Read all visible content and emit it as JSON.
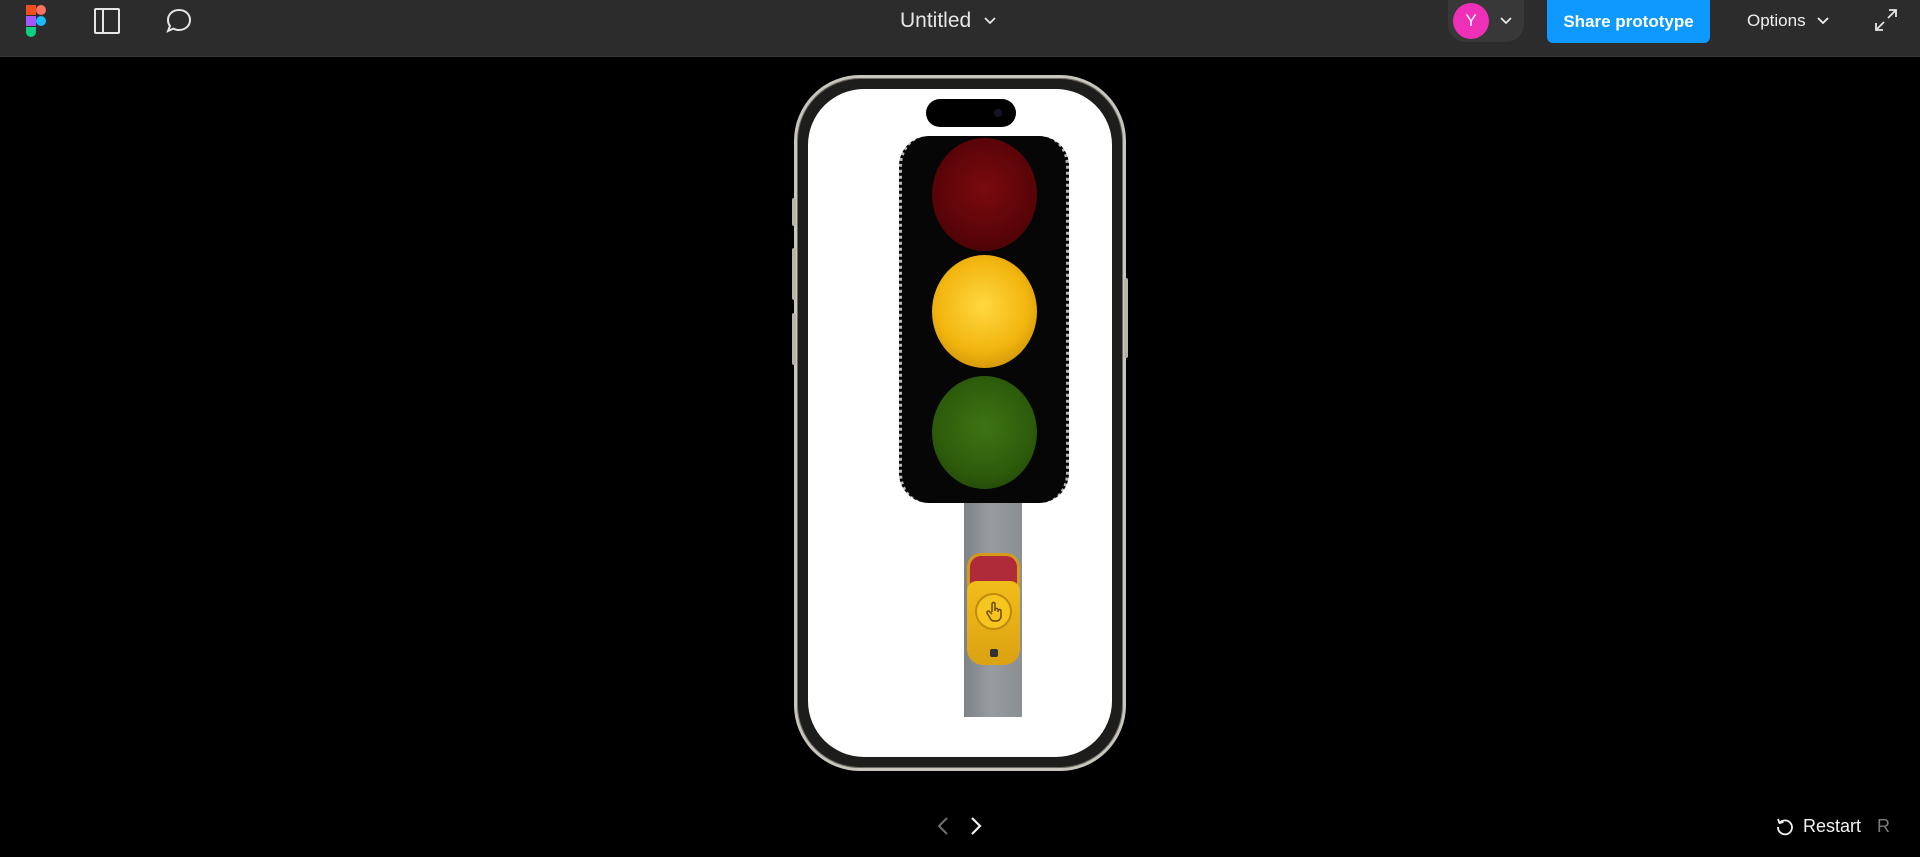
{
  "header": {
    "title": "Untitled",
    "avatar_initial": "Y",
    "share_label": "Share prototype",
    "options_label": "Options"
  },
  "footer": {
    "restart_label": "Restart",
    "restart_shortcut": "R"
  },
  "colors": {
    "topbar_bg": "#2c2c2c",
    "share_button": "#0d99ff",
    "avatar": "#ee2fb8",
    "canvas_bg": "#000000"
  },
  "icons": {
    "logo": "figma-logo-icon",
    "panel": "sidebar-panel-icon",
    "comment": "comment-bubble-icon",
    "title_dropdown": "chevron-down-icon",
    "avatar_dropdown": "chevron-down-icon",
    "options_dropdown": "chevron-down-icon",
    "fullscreen": "expand-icon",
    "previous": "chevron-left-icon",
    "next": "chevron-right-icon",
    "restart": "restart-icon"
  },
  "prototype": {
    "device": "iPhone",
    "traffic_light_active": "yellow",
    "pedestrian_button": "push-button-icon"
  }
}
